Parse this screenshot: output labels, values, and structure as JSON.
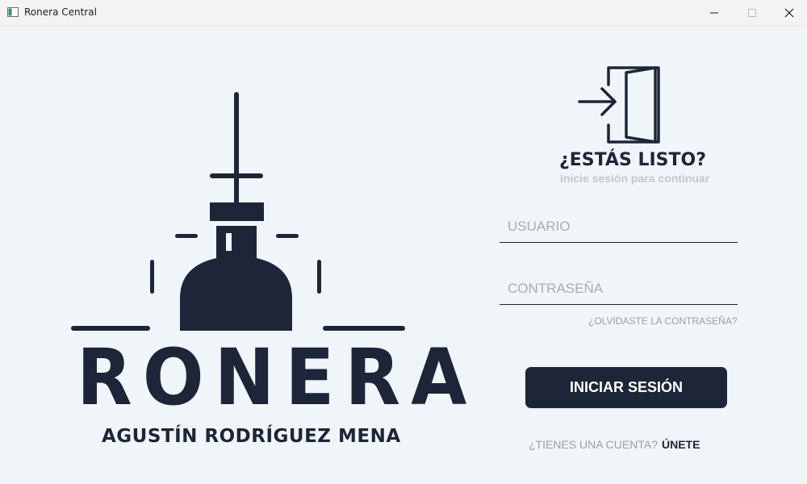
{
  "window": {
    "title": "Ronera Central",
    "icons": {
      "app": "app-window-icon",
      "minimize": "minimize-icon",
      "maximize": "maximize-icon",
      "close": "close-icon"
    }
  },
  "brand": {
    "name": "RONERA",
    "subtitle": "AGUSTÍN RODRÍGUEZ MENA",
    "logo_icon": "distillery-still-icon",
    "color": "#1d2638"
  },
  "login": {
    "icon": "sign-in-door-icon",
    "title": "¿ESTÁS LISTO?",
    "subtitle": "Inicie sesión para continuar",
    "username_placeholder": "USUARIO",
    "password_placeholder": "CONTRASEÑA",
    "forgot_label": "¿OLVIDASTE LA CONTRASEÑA?",
    "submit_label": "INICIAR SESIÓN",
    "signup_question": "¿TIENES UNA CUENTA?",
    "signup_link": "ÚNETE"
  },
  "colors": {
    "background": "#f0f5f9",
    "accent": "#1d2638",
    "muted": "#9aa0a6"
  }
}
